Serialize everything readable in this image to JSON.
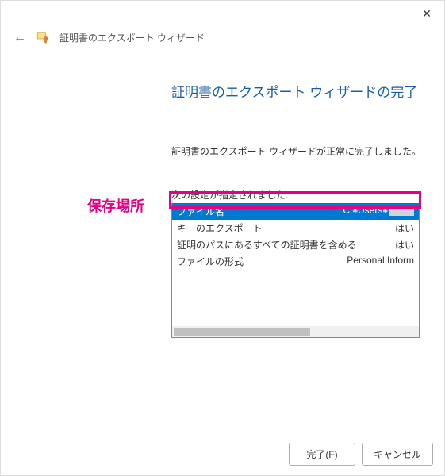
{
  "window": {
    "close": "✕"
  },
  "header": {
    "back": "←",
    "title": "証明書のエクスポート ウィザード"
  },
  "content": {
    "heading": "証明書のエクスポート ウィザードの完了",
    "completion_msg": "証明書のエクスポート ウィザードが正常に完了しました。",
    "settings_label": "次の設定が指定されました:"
  },
  "annotation": {
    "save_location": "保存場所"
  },
  "table": {
    "rows": [
      {
        "label": "ファイル名",
        "value": "C:¥Users¥"
      },
      {
        "label": "キーのエクスポート",
        "value": "はい"
      },
      {
        "label": "証明のパスにあるすべての証明書を含める",
        "value": "はい"
      },
      {
        "label": "ファイルの形式",
        "value": "Personal Inform"
      }
    ]
  },
  "footer": {
    "finish": "完了(F)",
    "cancel": "キャンセル"
  }
}
